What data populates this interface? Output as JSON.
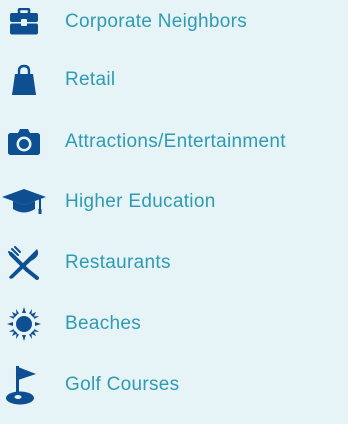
{
  "colors": {
    "background": "#e6f4f7",
    "icon": "#0d4f91",
    "label": "#2f9bb3"
  },
  "legend": {
    "items": [
      {
        "label": "Corporate Neighbors",
        "icon": "briefcase-icon"
      },
      {
        "label": "Retail",
        "icon": "shopping-bag-icon"
      },
      {
        "label": "Attractions/Entertainment",
        "icon": "camera-icon"
      },
      {
        "label": "Higher Education",
        "icon": "graduation-cap-icon"
      },
      {
        "label": "Restaurants",
        "icon": "fork-knife-icon"
      },
      {
        "label": "Beaches",
        "icon": "sun-icon"
      },
      {
        "label": "Golf Courses",
        "icon": "golf-flag-icon"
      }
    ]
  }
}
